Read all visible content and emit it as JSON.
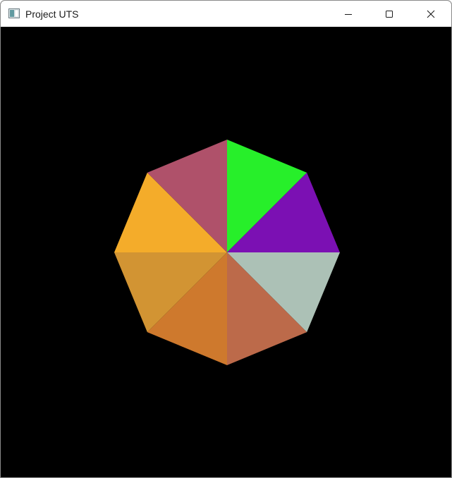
{
  "window": {
    "title": "Project UTS",
    "app_icon": "window-app-icon",
    "controls": {
      "minimize": "minimize-icon",
      "maximize": "maximize-icon",
      "close": "close-icon"
    }
  },
  "scene": {
    "background": "#000000",
    "shape": "octagon",
    "segments": [
      {
        "name": "triangle-top-right",
        "color": "#27EF2A"
      },
      {
        "name": "triangle-right-upper",
        "color": "#7B10B3"
      },
      {
        "name": "triangle-right-lower",
        "color": "#ACC1B6"
      },
      {
        "name": "triangle-bottom-right",
        "color": "#BC6A4A"
      },
      {
        "name": "triangle-bottom-left",
        "color": "#CE792D"
      },
      {
        "name": "triangle-left-lower",
        "color": "#D29433"
      },
      {
        "name": "triangle-left-upper",
        "color": "#F4AC2A"
      },
      {
        "name": "triangle-top-left",
        "color": "#AF516A"
      }
    ]
  }
}
